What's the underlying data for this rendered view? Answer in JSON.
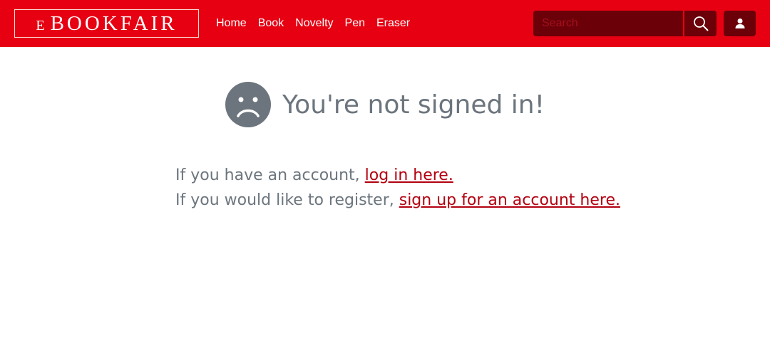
{
  "header": {
    "logo_prefix": "E",
    "logo_main": "BOOKFAIR",
    "nav_items": [
      {
        "label": "Home"
      },
      {
        "label": "Book"
      },
      {
        "label": "Novelty"
      },
      {
        "label": "Pen"
      },
      {
        "label": "Eraser"
      }
    ],
    "search": {
      "placeholder": "Search",
      "icon": "search-icon"
    },
    "user_icon": "user-icon",
    "background_color": "#e60012",
    "control_color": "#6b0009"
  },
  "main": {
    "status_icon": "sad-face-icon",
    "title": "You're not signed in!",
    "account_prompt": "If you have an account, ",
    "login_link": "log in here.",
    "register_prompt": "If you would like to register, ",
    "signup_link": "sign up for an account here.",
    "text_color": "#6c757d",
    "link_color": "#b30010"
  }
}
